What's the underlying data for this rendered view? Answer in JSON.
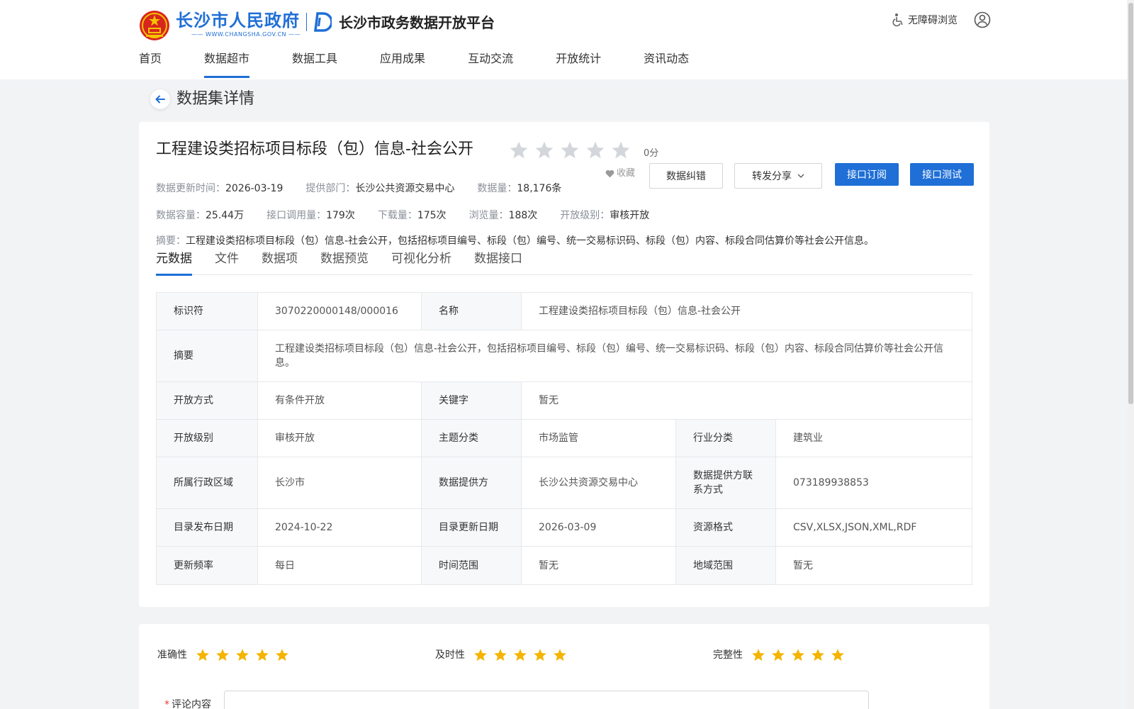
{
  "header": {
    "city_logo_text": "长沙市人民政府",
    "city_logo_url": "—— WWW.CHANGSHA.GOV.CN ——",
    "platform_title": "长沙市政务数据开放平台",
    "accessibility_label": "无障碍浏览"
  },
  "nav": {
    "items": [
      {
        "label": "首页"
      },
      {
        "label": "数据超市"
      },
      {
        "label": "数据工具"
      },
      {
        "label": "应用成果"
      },
      {
        "label": "互动交流"
      },
      {
        "label": "开放统计"
      },
      {
        "label": "资讯动态"
      }
    ],
    "active_index": 1
  },
  "page_title": "数据集详情",
  "dataset": {
    "title": "工程建设类招标项目标段（包）信息-社会公开",
    "rating_stars": 0,
    "rating_max": 5,
    "score_text": "0分",
    "favorite_label": "收藏",
    "buttons": {
      "correct": "数据纠错",
      "share": "转发分享",
      "subscribe": "接口订阅",
      "test": "接口测试"
    },
    "meta_row1": [
      {
        "key": "数据更新时间：",
        "value": "2026-03-19"
      },
      {
        "key": "提供部门：",
        "value": "长沙公共资源交易中心"
      },
      {
        "key": "数据量：",
        "value": "18,176条"
      }
    ],
    "meta_row2": [
      {
        "key": "数据容量：",
        "value": "25.44万"
      },
      {
        "key": "接口调用量：",
        "value": "179次"
      },
      {
        "key": "下载量：",
        "value": "175次"
      },
      {
        "key": "浏览量：",
        "value": "188次"
      },
      {
        "key": "开放级别：",
        "value": "审核开放"
      }
    ],
    "summary_key": "摘要：",
    "summary_value": "工程建设类招标项目标段（包）信息-社会公开，包括招标项目编号、标段（包）编号、统一交易标识码、标段（包）内容、标段合同估算价等社会公开信息。"
  },
  "tabs": [
    {
      "label": "元数据"
    },
    {
      "label": "文件"
    },
    {
      "label": "数据项"
    },
    {
      "label": "数据预览"
    },
    {
      "label": "可视化分析"
    },
    {
      "label": "数据接口"
    }
  ],
  "active_tab": 0,
  "metadata": {
    "identifier_label": "标识符",
    "identifier": "3070220000148/000016",
    "name_label": "名称",
    "name": "工程建设类招标项目标段（包）信息-社会公开",
    "summary_label": "摘要",
    "summary": "工程建设类招标项目标段（包）信息-社会公开，包括招标项目编号、标段（包）编号、统一交易标识码、标段（包）内容、标段合同估算价等社会公开信息。",
    "open_method_label": "开放方式",
    "open_method": "有条件开放",
    "keywords_label": "关键字",
    "keywords": "暂无",
    "open_level_label": "开放级别",
    "open_level": "审核开放",
    "theme_label": "主题分类",
    "theme": "市场监管",
    "industry_label": "行业分类",
    "industry": "建筑业",
    "region_label": "所属行政区域",
    "region": "长沙市",
    "provider_label": "数据提供方",
    "provider": "长沙公共资源交易中心",
    "contact_label": "数据提供方联系方式",
    "contact": "073189938853",
    "publish_date_label": "目录发布日期",
    "publish_date": "2024-10-22",
    "update_date_label": "目录更新日期",
    "update_date": "2026-03-09",
    "format_label": "资源格式",
    "format": "CSV,XLSX,JSON,XML,RDF",
    "frequency_label": "更新频率",
    "frequency": "每日",
    "time_range_label": "时间范围",
    "time_range": "暂无",
    "geo_range_label": "地域范围",
    "geo_range": "暂无"
  },
  "review": {
    "accuracy_label": "准确性",
    "timeliness_label": "及时性",
    "completeness_label": "完整性",
    "stars_each": 5,
    "comment_label": "评论内容",
    "required_mark": "*"
  },
  "colors": {
    "brand_blue": "#1f6fd6",
    "star_gray": "#d3d6db",
    "star_gold": "#f5b400"
  }
}
